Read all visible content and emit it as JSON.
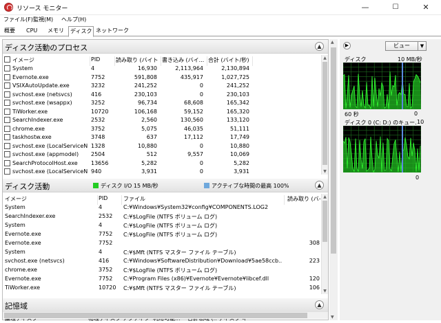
{
  "window": {
    "title": "リソース モニター",
    "min": "—",
    "max": "☐",
    "close": "✕"
  },
  "menu": [
    "ファイル(F)",
    "監視(M)",
    "ヘルプ(H)"
  ],
  "tabs": [
    "概要",
    "CPU",
    "メモリ",
    "ディスク",
    "ネットワーク"
  ],
  "processes": {
    "title": "ディスク活動のプロセス",
    "columns": [
      "イメージ",
      "PID",
      "読み取り (バイト...",
      "書き込み (バイ...",
      "合計 (バイト/秒)"
    ],
    "rows": [
      [
        "System",
        "4",
        "16,930",
        "2,113,964",
        "2,130,894"
      ],
      [
        "Evernote.exe",
        "7752",
        "591,808",
        "435,917",
        "1,027,725"
      ],
      [
        "VSIXAutoUpdate.exe",
        "3232",
        "241,252",
        "0",
        "241,252"
      ],
      [
        "svchost.exe (netsvcs)",
        "416",
        "230,103",
        "0",
        "230,103"
      ],
      [
        "svchost.exe (wsappx)",
        "3252",
        "96,734",
        "68,608",
        "165,342"
      ],
      [
        "TiWorker.exe",
        "10720",
        "106,168",
        "59,152",
        "165,320"
      ],
      [
        "SearchIndexer.exe",
        "2532",
        "2,560",
        "130,560",
        "133,120"
      ],
      [
        "chrome.exe",
        "3752",
        "5,075",
        "46,035",
        "51,111"
      ],
      [
        "taskhostw.exe",
        "3748",
        "637",
        "17,112",
        "17,749"
      ],
      [
        "svchost.exe (LocalServiceN...",
        "1328",
        "10,880",
        "0",
        "10,880"
      ],
      [
        "svchost.exe (appmodel)",
        "2504",
        "512",
        "9,557",
        "10,069"
      ],
      [
        "SearchProtocolHost.exe",
        "13656",
        "5,282",
        "0",
        "5,282"
      ],
      [
        "svchost.exe (LocalServiceN...",
        "940",
        "3,931",
        "0",
        "3,931"
      ]
    ]
  },
  "activity": {
    "title": "ディスク活動",
    "legend1": "ディスク I/O 15 MB/秒",
    "legend1_color": "#22cc22",
    "legend2": "アクティブな時間の最高 100%",
    "legend2_color": "#6fa8dc",
    "columns": [
      "イメージ",
      "PID",
      "ファイル",
      "読み取り (バイ"
    ],
    "rows": [
      [
        "System",
        "4",
        "C:¥Windows¥System32¥config¥COMPONENTS.LOG2",
        ""
      ],
      [
        "SearchIndexer.exe",
        "2532",
        "C:¥$LogFile (NTFS ボリューム ログ)",
        ""
      ],
      [
        "System",
        "4",
        "C:¥$LogFile (NTFS ボリューム ログ)",
        ""
      ],
      [
        "Evernote.exe",
        "7752",
        "C:¥$LogFile (NTFS ボリューム ログ)",
        ""
      ],
      [
        "Evernote.exe",
        "7752",
        "",
        "308"
      ],
      [
        "System",
        "4",
        "C:¥$Mft (NTFS マスター ファイル テーブル)",
        ""
      ],
      [
        "svchost.exe (netsvcs)",
        "416",
        "C:¥Windows¥SoftwareDistribution¥Download¥5ae58ccb...",
        "223"
      ],
      [
        "chrome.exe",
        "3752",
        "C:¥$LogFile (NTFS ボリューム ログ)",
        ""
      ],
      [
        "Evernote.exe",
        "7752",
        "C:¥Program Files (x86)¥Evernote¥Evernote¥libcef.dll",
        "120"
      ],
      [
        "TiWorker.exe",
        "10720",
        "C:¥$Mft (NTFS マスター ファイル テーブル)",
        "106"
      ]
    ]
  },
  "storage": {
    "title": "記憶域",
    "columns": [
      "論理ディスク",
      "物理ディスク",
      "アクティブ...",
      "利用可能...",
      "合計領域 (...",
      "ディスク キ..."
    ]
  },
  "right": {
    "view_label": "ビュー",
    "disk_label": "ディスク",
    "disk_rate": "10 MB/秒",
    "disk_time": "60 秒",
    "disk_min": "0",
    "disk0_label": "ディスク 0 (C: D:) のキュー...",
    "disk0_max": "10",
    "disk0_min": "0"
  },
  "graph_colors": {
    "grid": "#1e6b1e",
    "line": "#33ff33",
    "fill": "#22bb22",
    "accent": "#5a8ae0"
  }
}
